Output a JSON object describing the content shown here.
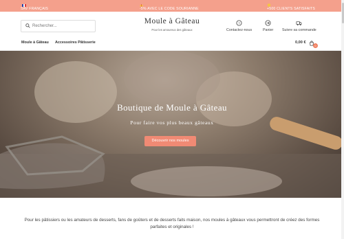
{
  "topbar": {
    "left": "SAV FRANÇAIS",
    "center": "-5% AVEC LE CODE SOURIANNE",
    "right": "+500 CLIENTS SATISFAITS"
  },
  "header": {
    "search_placeholder": "Rechercher...",
    "logo_title": "Moule à Gâteau",
    "logo_subtitle": "Pour les amoureux des gâteaux",
    "links": {
      "contact": "Contactez-nous",
      "cart": "Panier",
      "track": "Suivre sa commande"
    }
  },
  "nav": {
    "items": [
      "Moule à Gâteau",
      "Accessoires Pâtisserie"
    ],
    "cart_total": "0,00 €",
    "cart_count": "0"
  },
  "hero": {
    "title": "Boutique de Moule à Gâteau",
    "subtitle": "Pour faire vos plus beaux gâteaux",
    "button": "Découvrir nos moules"
  },
  "intro": {
    "text": "Pour les pâtissiers ou les amateurs de desserts, fans de goûters et de desserts faits maison, nos moules à gâteaux vous permettront de créez des formes parfaites et originales !"
  },
  "colors": {
    "accent": "#f4a08c",
    "button": "#f08a74"
  }
}
